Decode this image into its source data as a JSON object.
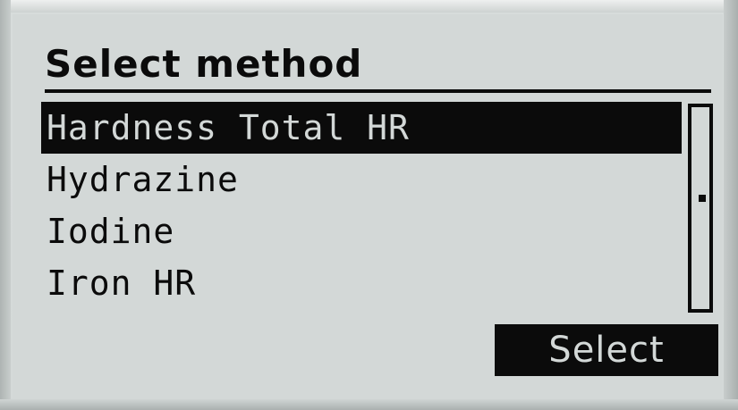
{
  "screen": {
    "title": "Select method",
    "methods": [
      {
        "label": "Hardness Total HR",
        "selected": true
      },
      {
        "label": "Hydrazine",
        "selected": false
      },
      {
        "label": "Iodine",
        "selected": false
      },
      {
        "label": "Iron HR",
        "selected": false
      }
    ],
    "scroll_position": 0.45,
    "softkey": {
      "label": "Select"
    }
  },
  "colors": {
    "lcd_background": "#d3d8d7",
    "lcd_foreground": "#0b0b0b",
    "bezel": "#c8cdcc"
  }
}
